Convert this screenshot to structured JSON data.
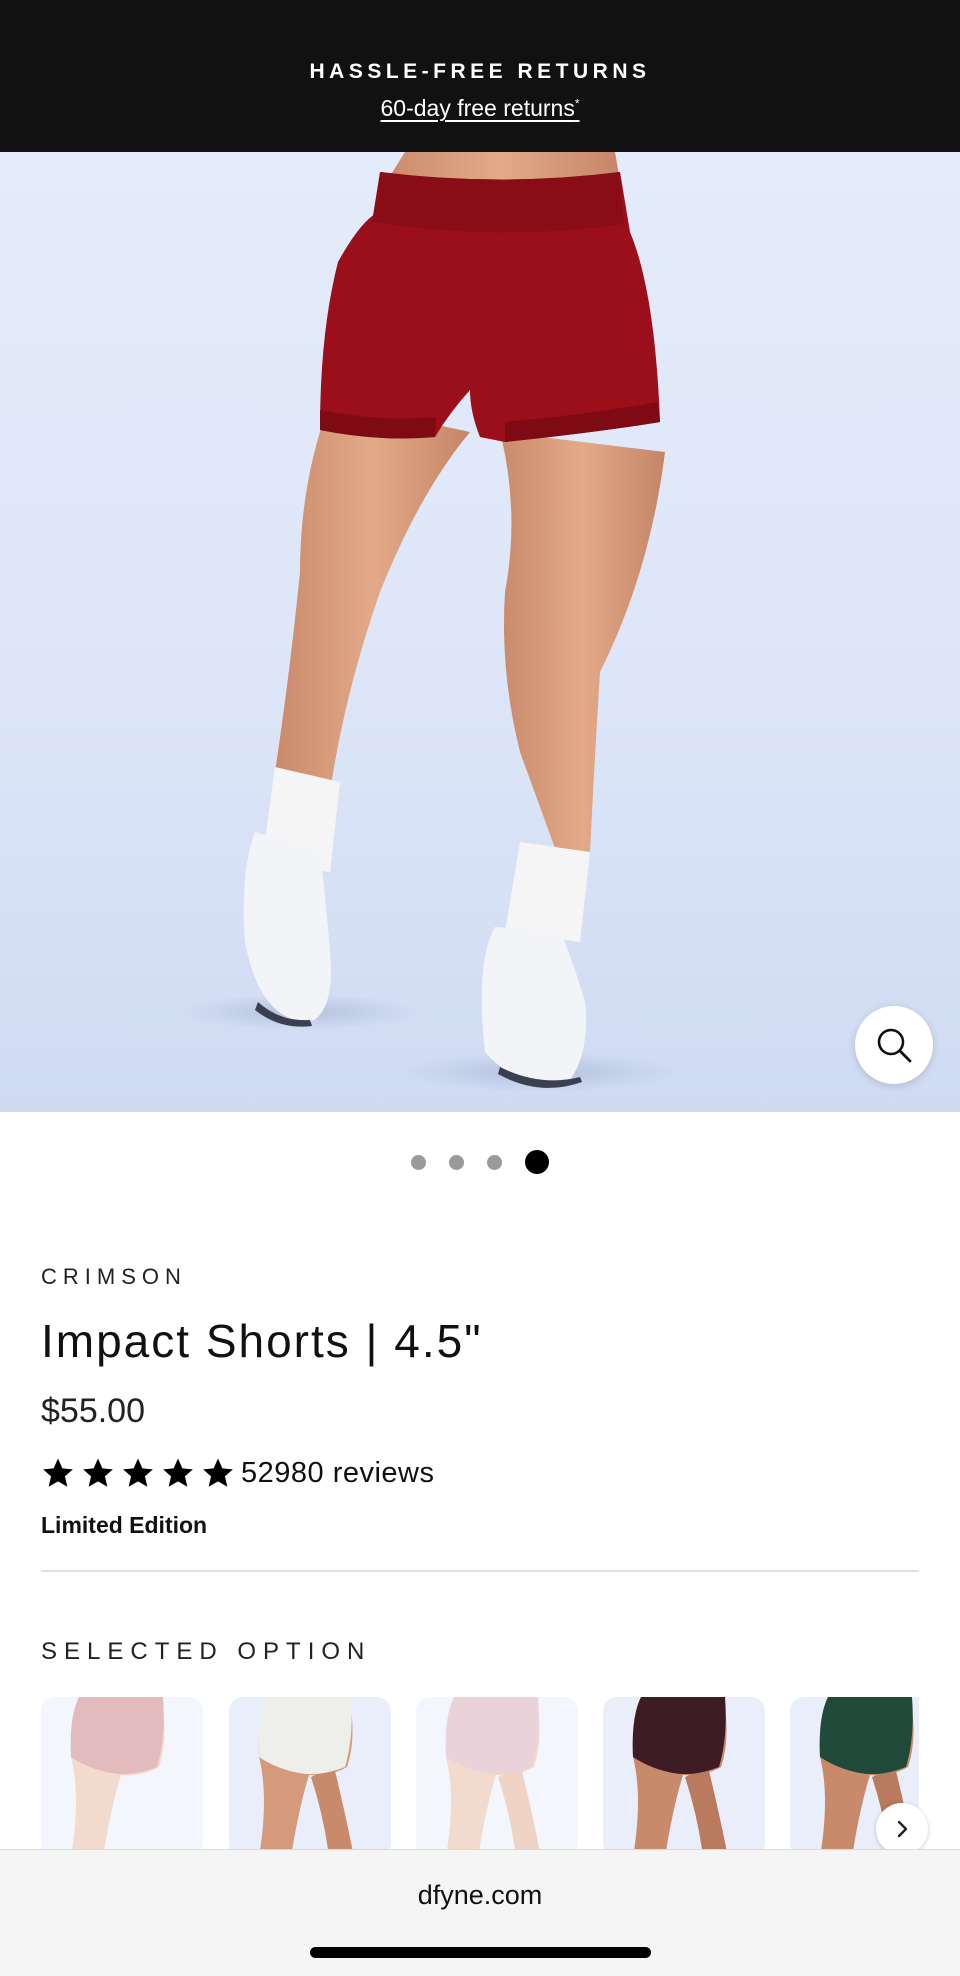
{
  "promo": {
    "title": "HASSLE-FREE RETURNS",
    "link": "60-day free returns",
    "link_marker": "*"
  },
  "gallery": {
    "image_count": 4,
    "active_index": 4,
    "zoom_icon": "search-icon"
  },
  "product": {
    "color": "CRIMSON",
    "title": "Impact Shorts | 4.5\"",
    "price": "$55.00",
    "rating": 5,
    "reviews": "52980 reviews",
    "edition": "Limited Edition"
  },
  "options": {
    "label": "SELECTED OPTION",
    "swatch_colors": [
      "#c97a7e",
      "#eeeeea",
      "#d4a7b4",
      "#3d1c24",
      "#1f4a3a"
    ],
    "next_icon": "chevron-right-icon"
  },
  "colors": {
    "short_color": "#9b0f1b",
    "banner_bg": "#111111"
  },
  "browser": {
    "url": "dfyne.com"
  }
}
